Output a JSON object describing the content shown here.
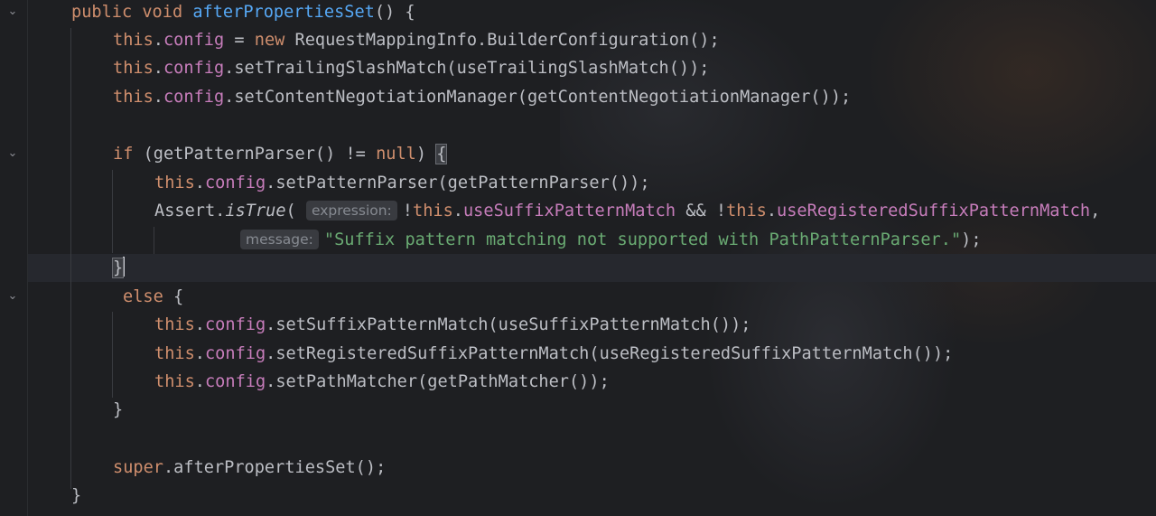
{
  "editor": {
    "lines": [
      {
        "id": "l1"
      },
      {
        "id": "l2"
      }
    ],
    "tokens": {
      "l1_kw": "public void ",
      "l1_fn": "afterPropertiesSet",
      "l1_rest": "() {",
      "l2_this": "this",
      "l2_dot": ".",
      "l2_cfg": "config",
      "l2_eq": " = ",
      "l2_new": "new ",
      "l2_rest": "RequestMappingInfo.BuilderConfiguration();",
      "l3_this": "this",
      "l3_dot": ".",
      "l3_cfg": "config",
      "l3_rest": ".setTrailingSlashMatch(useTrailingSlashMatch());",
      "l4_this": "this",
      "l4_dot": ".",
      "l4_cfg": "config",
      "l4_rest": ".setContentNegotiationManager(getContentNegotiationManager());",
      "l6_if": "if",
      "l6_mid": " (getPatternParser() != ",
      "l6_null": "null",
      "l6_close": ") ",
      "l6_brace": "{",
      "l7_this": "this",
      "l7_dot": ".",
      "l7_cfg": "config",
      "l7_rest": ".setPatternParser(getPatternParser());",
      "l8_assert": "Assert.",
      "l8_istrue": "isTrue",
      "l8_paren": "(",
      "l8_hint": "expression:",
      "l8_not1": "!",
      "l8_this1": "this",
      "l8_dot1": ".",
      "l8_f1": "useSuffixPatternMatch",
      "l8_and": " && !",
      "l8_this2": "this",
      "l8_dot2": ".",
      "l8_f2": "useRegisteredSuffixPatternMatch",
      "l8_comma": ",",
      "l9_hint": "message:",
      "l9_str": "\"Suffix pattern matching not supported with PathPatternParser.\"",
      "l9_end": ");",
      "l10_brace": "}",
      "l11_else": "else",
      "l11_brace": " {",
      "l12_this": "this",
      "l12_dot": ".",
      "l12_cfg": "config",
      "l12_rest": ".setSuffixPatternMatch(useSuffixPatternMatch());",
      "l13_this": "this",
      "l13_dot": ".",
      "l13_cfg": "config",
      "l13_rest": ".setRegisteredSuffixPatternMatch(useRegisteredSuffixPatternMatch());",
      "l14_this": "this",
      "l14_dot": ".",
      "l14_cfg": "config",
      "l14_rest": ".setPathMatcher(getPathMatcher());",
      "l15_brace": "}",
      "l17_super": "super",
      "l17_rest": ".afterPropertiesSet();",
      "l18_brace": "}"
    },
    "fold_icon": "chevron-down-icon",
    "colors": {
      "background": "#1e1f22",
      "keyword": "#cf8e6d",
      "field": "#c77dbb",
      "method_decl": "#56a8f5",
      "string": "#6aab73",
      "text": "#bcbec4"
    }
  }
}
